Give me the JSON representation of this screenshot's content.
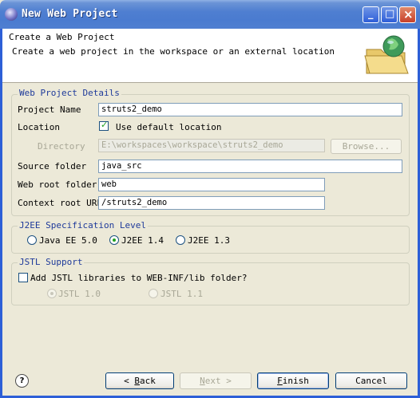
{
  "window": {
    "title": "New Web Project",
    "minimize_glyph": "_",
    "maximize_glyph": "□",
    "close_glyph": "×"
  },
  "banner": {
    "title": "Create a Web Project",
    "description": "Create a web project in the workspace or an external location",
    "icon": "folder-globe-icon"
  },
  "details": {
    "legend": "Web Project Details",
    "project_name_label": "Project Name",
    "project_name_value": "struts2_demo",
    "location_label": "Location",
    "use_default_label": "Use default location",
    "use_default_checked": true,
    "directory_label": "Directory",
    "directory_value": "E:\\workspaces\\workspace\\struts2_demo",
    "browse_label": "Browse...",
    "source_folder_label": "Source folder",
    "source_folder_value": "java_src",
    "web_root_label": "Web root folder",
    "web_root_value": "web",
    "context_root_label": "Context root URL",
    "context_root_value": "/struts2_demo"
  },
  "j2ee": {
    "legend": "J2EE Specification Level",
    "options": [
      "Java EE 5.0",
      "J2EE 1.4",
      "J2EE 1.3"
    ],
    "selected": "J2EE 1.4"
  },
  "jstl": {
    "legend": "JSTL Support",
    "add_label": "Add JSTL libraries to WEB-INF/lib folder?",
    "add_checked": false,
    "versions": [
      "JSTL 1.0",
      "JSTL 1.1"
    ],
    "selected": "JSTL 1.0"
  },
  "buttons": {
    "help": "?",
    "back_mnemonic": "< ",
    "back_key": "B",
    "back_rest": "ack",
    "next_key": "N",
    "next_rest": "ext >",
    "finish_key": "F",
    "finish_rest": "inish",
    "cancel": "Cancel"
  },
  "colors": {
    "accent": "#1e3a9a",
    "titlebar": "#4a7bd0",
    "check": "#21a121"
  }
}
